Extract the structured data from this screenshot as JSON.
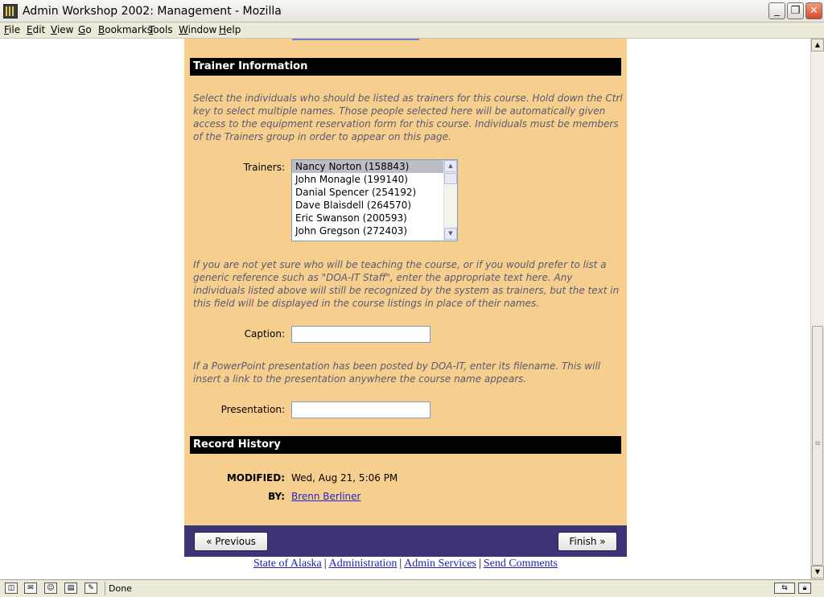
{
  "window": {
    "title": "Admin Workshop 2002: Management - Mozilla"
  },
  "menu": [
    "File",
    "Edit",
    "View",
    "Go",
    "Bookmarks",
    "Tools",
    "Window",
    "Help"
  ],
  "trainer_section": {
    "header": "Trainer Information",
    "help": "Select the individuals who should be listed as trainers for this course. Hold down the Ctrl key to select multiple names. Those people selected here will be automatically given access to the equipment reservation form for this course. Individuals must be members of the Trainers group in order to appear on this page.",
    "trainers_label": "Trainers:",
    "trainers": [
      "Nancy Norton (158843)",
      "John Monagle (199140)",
      "Danial Spencer (254192)",
      "Dave Blaisdell (264570)",
      "Eric Swanson (200593)",
      "John Gregson (272403)"
    ],
    "selected_trainer": "Nancy Norton (158843)",
    "caption_help": "If you are not yet sure who will be teaching the course, or if you would prefer to list a generic reference such as \"DOA-IT Staff\", enter the appropriate text here. Any individuals listed above will still be recognized by the system as trainers, but the text in this field will be displayed in the course listings in place of their names.",
    "caption_label": "Caption:",
    "caption_value": "",
    "presentation_help": "If a PowerPoint presentation has been posted by DOA-IT, enter its filename. This will insert a link to the presentation anywhere the course name appears.",
    "presentation_label": "Presentation:",
    "presentation_value": ""
  },
  "record_history": {
    "header": "Record History",
    "modified_label": "MODIFIED:",
    "modified_value": "Wed, Aug 21, 5:06 PM",
    "by_label": "BY:",
    "by_value": "Brenn Berliner"
  },
  "buttons": {
    "previous": "« Previous",
    "finish": "Finish »"
  },
  "footer_links": [
    "State of Alaska",
    "Administration",
    "Admin Services",
    "Send Comments"
  ],
  "status": {
    "text": "Done"
  },
  "colors": {
    "page_bg": "#f6cf8e",
    "header_bg": "#000000",
    "nav_bar": "#3d3375",
    "link": "#2222cc"
  }
}
